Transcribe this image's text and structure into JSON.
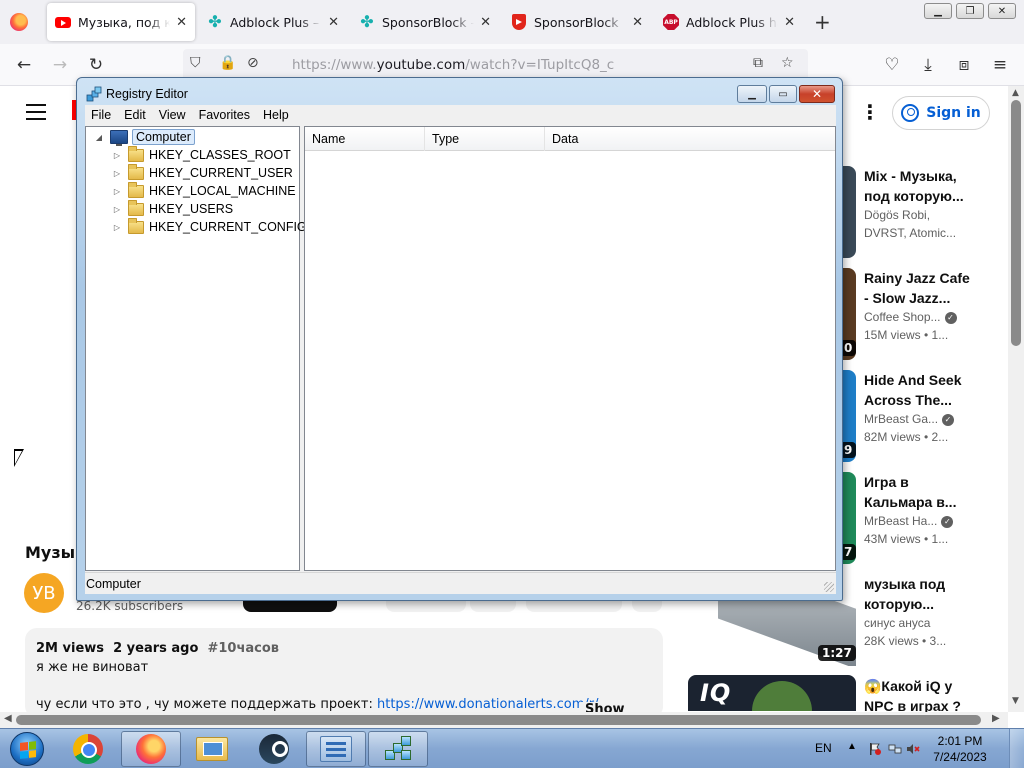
{
  "browser": {
    "tabs": [
      {
        "label": "Музыка, под которую",
        "icon": "youtube-icon",
        "active": true
      },
      {
        "label": "Adblock Plus – Des",
        "icon": "sponsorblock-icon",
        "active": false
      },
      {
        "label": "SponsorBlock - Sk",
        "icon": "sponsorblock-icon",
        "active": false
      },
      {
        "label": "SponsorBlock",
        "icon": "shield-icon",
        "active": false
      },
      {
        "label": "Adblock Plus has",
        "icon": "adblock-plus-icon",
        "active": false
      }
    ],
    "url_prefix": "https://www.",
    "url_domain": "youtube.com",
    "url_rest": "/watch?v=ITupItcQ8_c"
  },
  "youtube": {
    "sign_in": "Sign in",
    "video_title": "Музыка",
    "channel_avatar": "УВ",
    "subscribers": "26.2K subscribers",
    "description": {
      "views": "2M views",
      "age": "2 years ago",
      "hashtag": "#10часов",
      "line1": "я же не виноват",
      "line2_text": "чу если что это , чу можете поддержать проект: ",
      "line2_link": "https://www.donationalerts.com/r/",
      "show_more": "Show more"
    },
    "recommendations": [
      {
        "title": "Mix - Музыка, под которую...",
        "sub1": "Dögös Robi,",
        "sub2": "DVRST, Atomic...",
        "verified": false
      },
      {
        "title": "Rainy Jazz Cafe - Slow Jazz...",
        "sub1": "Coffee Shop...",
        "sub2": "15M views  •  1...",
        "verified": true
      },
      {
        "title": "Hide And Seek Across The...",
        "sub1": "MrBeast Ga...",
        "sub2": "82M views  •  2...",
        "verified": true
      },
      {
        "title": "Игра в Кальмара в...",
        "sub1": "MrBeast Ha...",
        "sub2": "43M views  •  1...",
        "verified": true
      },
      {
        "title": "музыка под которую...",
        "sub1": "синус ануса",
        "sub2": "28K views  •  3...",
        "verified": false
      },
      {
        "title": "😱Какой iQ у NPC в играх ?",
        "sub1": "",
        "sub2": "",
        "verified": false
      }
    ],
    "durations": [
      "0",
      "9",
      "7",
      "1:27"
    ],
    "thumb_text": "IQ"
  },
  "regedit": {
    "title": "Registry Editor",
    "menu": [
      "File",
      "Edit",
      "View",
      "Favorites",
      "Help"
    ],
    "root": "Computer",
    "hives": [
      "HKEY_CLASSES_ROOT",
      "HKEY_CURRENT_USER",
      "HKEY_LOCAL_MACHINE",
      "HKEY_USERS",
      "HKEY_CURRENT_CONFIG"
    ],
    "columns": [
      "Name",
      "Type",
      "Data"
    ],
    "status": "Computer"
  },
  "taskbar": {
    "language": "EN",
    "time": "2:01 PM",
    "date": "7/24/2023"
  },
  "colors": {
    "youtube_red": "#ff0000",
    "link_blue": "#065fd4",
    "avatar_orange": "#f5a623"
  }
}
